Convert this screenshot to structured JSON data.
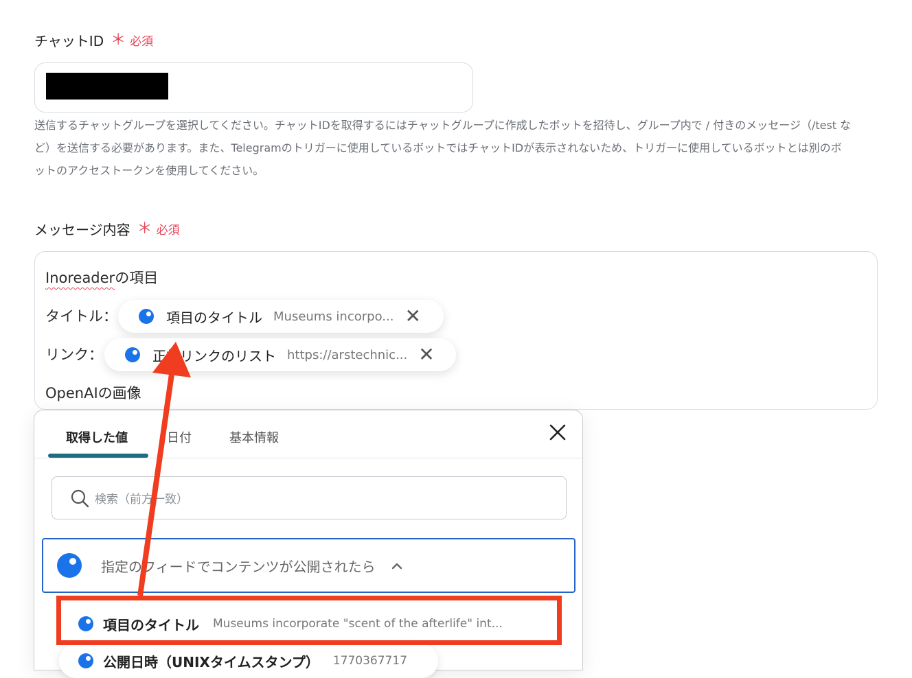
{
  "chat_id": {
    "label": "チャットID",
    "required_star": "＊",
    "required_text": "必須",
    "help_lines": [
      "送信するチャットグループを選択してください。チャットIDを取得するにはチャットグループに作成したボットを招待し、グループ内で / 付きのメッセージ（/test な",
      "ど）を送信する必要があります。また、Telegramのトリガーに使用しているボットではチャットIDが表示されないため、トリガーに使用しているボットとは別のボ",
      "ットのアクセストークンを使用してください。"
    ]
  },
  "message": {
    "label": "メッセージ内容",
    "required_star": "＊",
    "required_text": "必須",
    "line1_spell": "Inoreader",
    "line1_rest": "の項目",
    "title_label": "タイトル：",
    "link_label": "リンク：",
    "line4": "OpenAIの画像",
    "pills": [
      {
        "name": "項目のタイトル",
        "value": "Museums incorpo...",
        "icon": "close-icon"
      },
      {
        "name": "正規リンクのリスト",
        "value": "https://arstechnic...",
        "icon": "close-icon"
      }
    ]
  },
  "picker": {
    "tabs": [
      "取得した値",
      "日付",
      "基本情報"
    ],
    "active_tab": 0,
    "close_icon": "×",
    "search_placeholder": "検索（前方一致）",
    "group_title": "指定のフィードでコンテンツが公開されたら",
    "group_chevron": "⌃",
    "items": [
      {
        "name": "項目のタイトル",
        "value": "Museums incorporate \"scent of the afterlife\" int..."
      },
      {
        "name": "公開日時（UNIXタイムスタンプ）",
        "value": "1770367717"
      }
    ]
  },
  "colors": {
    "required": "#e8455a",
    "accent": "#1a73e8",
    "tab_underline": "#1f6b80",
    "highlight": "#f03c1f"
  }
}
